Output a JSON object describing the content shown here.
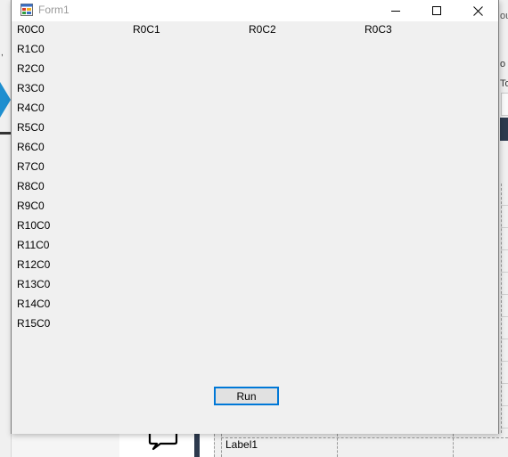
{
  "window": {
    "title": "Form1"
  },
  "grid": {
    "column_header_row": [
      "R0C0",
      "R0C1",
      "R0C2",
      "R0C3"
    ],
    "row_labels": [
      "R1C0",
      "R2C0",
      "R3C0",
      "R4C0",
      "R5C0",
      "R6C0",
      "R7C0",
      "R8C0",
      "R9C0",
      "R10C0",
      "R11C0",
      "R12C0",
      "R13C0",
      "R14C0",
      "R15C0"
    ]
  },
  "run_button": {
    "label": "Run"
  },
  "background": {
    "designer_label": "Label1",
    "right_edge_texts": [
      "ou",
      "o",
      "To"
    ],
    "left_edge_text": ","
  },
  "colors": {
    "accent": "#0078d7",
    "window_bg": "#f0f0f0",
    "titlebar_bg": "#ffffff",
    "title_text": "#9a9a9a"
  },
  "icons": {
    "app": "form-app-icon",
    "minimize": "minimize-icon",
    "maximize": "maximize-icon",
    "close": "close-icon",
    "comment": "speech-bubble-icon"
  }
}
